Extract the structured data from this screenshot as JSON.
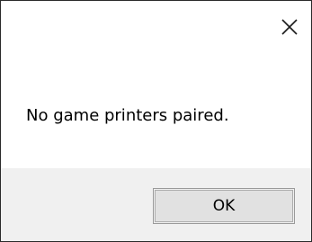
{
  "dialog": {
    "close_icon": "close-icon",
    "message": "No game printers paired.",
    "ok_label": "OK"
  }
}
